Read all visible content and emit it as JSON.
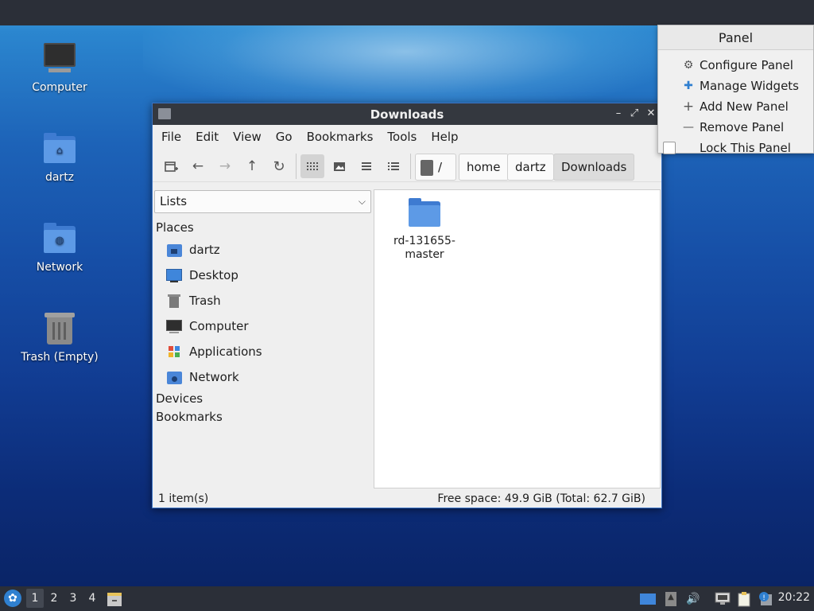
{
  "desktop": {
    "icons": [
      {
        "label": "Computer",
        "icon": "computer-icon"
      },
      {
        "label": "dartz",
        "icon": "home-folder-icon"
      },
      {
        "label": "Network",
        "icon": "network-folder-icon"
      },
      {
        "label": "Trash (Empty)",
        "icon": "trash-icon"
      }
    ]
  },
  "window": {
    "title": "Downloads",
    "controls": {
      "minimize": "–",
      "maximize": "⤢",
      "close": "✕"
    },
    "menus": [
      "File",
      "Edit",
      "View",
      "Go",
      "Bookmarks",
      "Tools",
      "Help"
    ],
    "toolbar": {
      "new_tab": "new-tab-icon",
      "back": "←",
      "forward": "→",
      "up": "↑",
      "reload": "↻",
      "views": [
        "icon-view",
        "thumbnail-view",
        "compact-view",
        "detail-view"
      ],
      "active_view": "icon-view"
    },
    "breadcrumb": {
      "root": "/",
      "items": [
        "home",
        "dartz",
        "Downloads"
      ],
      "active": "Downloads"
    },
    "sidebar": {
      "mode": "Lists",
      "places_label": "Places",
      "places": [
        "dartz",
        "Desktop",
        "Trash",
        "Computer",
        "Applications",
        "Network"
      ],
      "devices_label": "Devices",
      "bookmarks_label": "Bookmarks"
    },
    "files": [
      {
        "name": "rd-131655-\nmaster",
        "type": "folder"
      }
    ],
    "status": {
      "count": "1 item(s)",
      "free_space": "Free space: 49.9 GiB (Total: 62.7 GiB)"
    }
  },
  "panel_menu": {
    "title": "Panel",
    "items": [
      {
        "label": "Configure Panel",
        "icon": "gear-icon"
      },
      {
        "label": "Manage Widgets",
        "icon": "puzzle-icon"
      },
      {
        "label": "Add New Panel",
        "icon": "plus-icon"
      },
      {
        "label": "Remove Panel",
        "icon": "minus-icon"
      },
      {
        "label": "Lock This Panel",
        "icon": "checkbox",
        "checked": false
      }
    ]
  },
  "taskbar": {
    "workspaces": [
      "1",
      "2",
      "3",
      "4"
    ],
    "active_workspace": "1",
    "clock": "20:22"
  }
}
